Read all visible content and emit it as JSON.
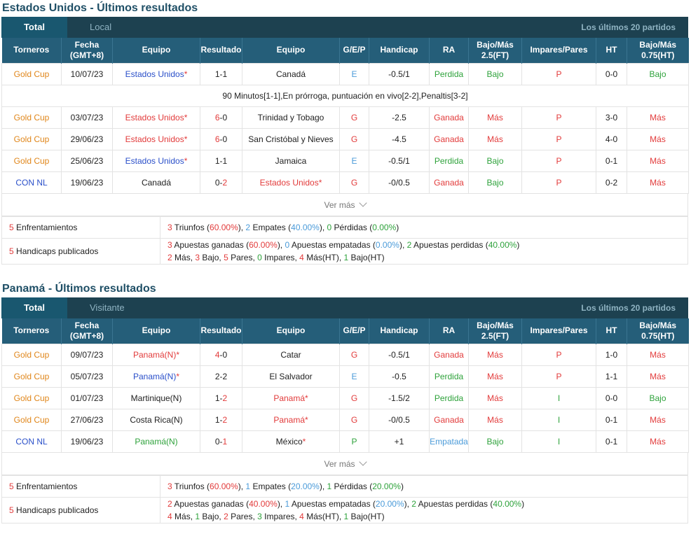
{
  "headers": [
    "Torneros",
    "Fecha\n(GMT+8)",
    "Equipo",
    "Resultado",
    "Equipo",
    "G/E/P",
    "Handicap",
    "RA",
    "Bajo/Más\n2.5(FT)",
    "Impares/Pares",
    "HT",
    "Bajo/Más\n0.75(HT)"
  ],
  "ver_mas": "Ver más",
  "colors": {
    "orange": "#e0861a",
    "blue": "#2a4fc9",
    "red": "#e23b3b",
    "green": "#2ea23b",
    "lightblue": "#4b9bd9",
    "header": "#255e79"
  },
  "sections": [
    {
      "title": "Estados Unidos - Últimos resultados",
      "tab_total": "Total",
      "tab_second": "Local",
      "tab_last": "Los últimos 20 partidos",
      "rows": [
        {
          "torneo": "Gold Cup",
          "torneo_c": "org",
          "fecha": "10/07/23",
          "home": "Estados Unidos",
          "home_star": "*",
          "home_c": "blue",
          "score_h": "1",
          "score_sep": "-",
          "score_a": "1",
          "sh_c": "dark",
          "sa_c": "dark",
          "away": "Canadá",
          "away_star": "",
          "away_c": "dark",
          "gep": "E",
          "gep_c": "lblue",
          "handicap": "-0.5/1",
          "ra": "Perdida",
          "ra_c": "green",
          "bm": "Bajo",
          "bm_c": "green",
          "ip": "P",
          "ip_c": "red",
          "ht": "0-0",
          "bmht": "Bajo",
          "bmht_c": "green"
        },
        {
          "note": "90 Minutos[1-1],En prórroga, puntuación en vivo[2-2],Penaltis[3-2]"
        },
        {
          "torneo": "Gold Cup",
          "torneo_c": "org",
          "fecha": "03/07/23",
          "home": "Estados Unidos",
          "home_star": "*",
          "home_c": "red",
          "score_h": "6",
          "score_sep": "-",
          "score_a": "0",
          "sh_c": "red",
          "sa_c": "dark",
          "away": "Trinidad y Tobago",
          "away_star": "",
          "away_c": "dark",
          "gep": "G",
          "gep_c": "red",
          "handicap": "-2.5",
          "ra": "Ganada",
          "ra_c": "red",
          "bm": "Más",
          "bm_c": "red",
          "ip": "P",
          "ip_c": "red",
          "ht": "3-0",
          "bmht": "Más",
          "bmht_c": "red"
        },
        {
          "torneo": "Gold Cup",
          "torneo_c": "org",
          "fecha": "29/06/23",
          "home": "Estados Unidos",
          "home_star": "*",
          "home_c": "red",
          "score_h": "6",
          "score_sep": "-",
          "score_a": "0",
          "sh_c": "red",
          "sa_c": "dark",
          "away": "San Cristóbal y Nieves",
          "away_star": "",
          "away_c": "dark",
          "gep": "G",
          "gep_c": "red",
          "handicap": "-4.5",
          "ra": "Ganada",
          "ra_c": "red",
          "bm": "Más",
          "bm_c": "red",
          "ip": "P",
          "ip_c": "red",
          "ht": "4-0",
          "bmht": "Más",
          "bmht_c": "red"
        },
        {
          "torneo": "Gold Cup",
          "torneo_c": "org",
          "fecha": "25/06/23",
          "home": "Estados Unidos",
          "home_star": "*",
          "home_c": "blue",
          "score_h": "1",
          "score_sep": "-",
          "score_a": "1",
          "sh_c": "dark",
          "sa_c": "dark",
          "away": "Jamaica",
          "away_star": "",
          "away_c": "dark",
          "gep": "E",
          "gep_c": "lblue",
          "handicap": "-0.5/1",
          "ra": "Perdida",
          "ra_c": "green",
          "bm": "Bajo",
          "bm_c": "green",
          "ip": "P",
          "ip_c": "red",
          "ht": "0-1",
          "bmht": "Más",
          "bmht_c": "red"
        },
        {
          "torneo": "CON NL",
          "torneo_c": "blue",
          "fecha": "19/06/23",
          "home": "Canadá",
          "home_star": "",
          "home_c": "dark",
          "score_h": "0",
          "score_sep": "-",
          "score_a": "2",
          "sh_c": "dark",
          "sa_c": "red",
          "away": "Estados Unidos",
          "away_star": "*",
          "away_c": "red",
          "gep": "G",
          "gep_c": "red",
          "handicap": "-0/0.5",
          "ra": "Ganada",
          "ra_c": "red",
          "bm": "Bajo",
          "bm_c": "green",
          "ip": "P",
          "ip_c": "red",
          "ht": "0-2",
          "bmht": "Más",
          "bmht_c": "red"
        }
      ],
      "summary": {
        "enf_count": "5",
        "enf_label": " Enfrentamientos",
        "enf_parts": [
          {
            "t": "3",
            "c": "red"
          },
          {
            "t": " Triunfos (",
            "c": "dark"
          },
          {
            "t": "60.00%",
            "c": "red"
          },
          {
            "t": "), ",
            "c": "dark"
          },
          {
            "t": "2",
            "c": "lblue"
          },
          {
            "t": " Empates (",
            "c": "dark"
          },
          {
            "t": "40.00%",
            "c": "lblue"
          },
          {
            "t": "), ",
            "c": "dark"
          },
          {
            "t": "0",
            "c": "green"
          },
          {
            "t": " Pérdidas (",
            "c": "dark"
          },
          {
            "t": "0.00%",
            "c": "green"
          },
          {
            "t": ")",
            "c": "dark"
          }
        ],
        "hand_count": "5",
        "hand_label": " Handicaps publicados",
        "hand_line1": [
          {
            "t": "3",
            "c": "red"
          },
          {
            "t": " Apuestas ganadas (",
            "c": "dark"
          },
          {
            "t": "60.00%",
            "c": "red"
          },
          {
            "t": "), ",
            "c": "dark"
          },
          {
            "t": "0",
            "c": "lblue"
          },
          {
            "t": " Apuestas empatadas (",
            "c": "dark"
          },
          {
            "t": "0.00%",
            "c": "lblue"
          },
          {
            "t": "), ",
            "c": "dark"
          },
          {
            "t": "2",
            "c": "green"
          },
          {
            "t": " Apuestas perdidas (",
            "c": "dark"
          },
          {
            "t": "40.00%",
            "c": "green"
          },
          {
            "t": ")",
            "c": "dark"
          }
        ],
        "hand_line2": [
          {
            "t": "2",
            "c": "red"
          },
          {
            "t": " Más, ",
            "c": "dark"
          },
          {
            "t": "3",
            "c": "red"
          },
          {
            "t": " Bajo, ",
            "c": "dark"
          },
          {
            "t": "5",
            "c": "red"
          },
          {
            "t": " Pares, ",
            "c": "dark"
          },
          {
            "t": "0",
            "c": "green"
          },
          {
            "t": " Impares, ",
            "c": "dark"
          },
          {
            "t": "4",
            "c": "red"
          },
          {
            "t": " Más(HT), ",
            "c": "dark"
          },
          {
            "t": "1",
            "c": "green"
          },
          {
            "t": " Bajo(HT)",
            "c": "dark"
          }
        ]
      }
    },
    {
      "title": "Panamá - Últimos resultados",
      "tab_total": "Total",
      "tab_second": "Visitante",
      "tab_last": "Los últimos 20 partidos",
      "rows": [
        {
          "torneo": "Gold Cup",
          "torneo_c": "org",
          "fecha": "09/07/23",
          "home": "Panamá(N)",
          "home_star": "*",
          "home_c": "red",
          "score_h": "4",
          "score_sep": "-",
          "score_a": "0",
          "sh_c": "red",
          "sa_c": "dark",
          "away": "Catar",
          "away_star": "",
          "away_c": "dark",
          "gep": "G",
          "gep_c": "red",
          "handicap": "-0.5/1",
          "ra": "Ganada",
          "ra_c": "red",
          "bm": "Más",
          "bm_c": "red",
          "ip": "P",
          "ip_c": "red",
          "ht": "1-0",
          "bmht": "Más",
          "bmht_c": "red"
        },
        {
          "torneo": "Gold Cup",
          "torneo_c": "org",
          "fecha": "05/07/23",
          "home": "Panamá(N)",
          "home_star": "*",
          "home_c": "blue",
          "score_h": "2",
          "score_sep": "-",
          "score_a": "2",
          "sh_c": "dark",
          "sa_c": "dark",
          "away": "El Salvador",
          "away_star": "",
          "away_c": "dark",
          "gep": "E",
          "gep_c": "lblue",
          "handicap": "-0.5",
          "ra": "Perdida",
          "ra_c": "green",
          "bm": "Más",
          "bm_c": "red",
          "ip": "P",
          "ip_c": "red",
          "ht": "1-1",
          "bmht": "Más",
          "bmht_c": "red"
        },
        {
          "torneo": "Gold Cup",
          "torneo_c": "org",
          "fecha": "01/07/23",
          "home": "Martinique(N)",
          "home_star": "",
          "home_c": "dark",
          "score_h": "1",
          "score_sep": "-",
          "score_a": "2",
          "sh_c": "dark",
          "sa_c": "red",
          "away": "Panamá",
          "away_star": "*",
          "away_c": "red",
          "gep": "G",
          "gep_c": "red",
          "handicap": "-1.5/2",
          "ra": "Perdida",
          "ra_c": "green",
          "bm": "Más",
          "bm_c": "red",
          "ip": "I",
          "ip_c": "green",
          "ht": "0-0",
          "bmht": "Bajo",
          "bmht_c": "green"
        },
        {
          "torneo": "Gold Cup",
          "torneo_c": "org",
          "fecha": "27/06/23",
          "home": "Costa Rica(N)",
          "home_star": "",
          "home_c": "dark",
          "score_h": "1",
          "score_sep": "-",
          "score_a": "2",
          "sh_c": "dark",
          "sa_c": "red",
          "away": "Panamá",
          "away_star": "*",
          "away_c": "red",
          "gep": "G",
          "gep_c": "red",
          "handicap": "-0/0.5",
          "ra": "Ganada",
          "ra_c": "red",
          "bm": "Más",
          "bm_c": "red",
          "ip": "I",
          "ip_c": "green",
          "ht": "0-1",
          "bmht": "Más",
          "bmht_c": "red"
        },
        {
          "torneo": "CON NL",
          "torneo_c": "blue",
          "fecha": "19/06/23",
          "home": "Panamá(N)",
          "home_star": "",
          "home_c": "green",
          "score_h": "0",
          "score_sep": "-",
          "score_a": "1",
          "sh_c": "dark",
          "sa_c": "red",
          "away": "México",
          "away_star": "*",
          "away_c": "dark",
          "gep": "P",
          "gep_c": "green",
          "handicap": "+1",
          "ra": "Empatada",
          "ra_c": "lblue",
          "bm": "Bajo",
          "bm_c": "green",
          "ip": "I",
          "ip_c": "green",
          "ht": "0-1",
          "bmht": "Más",
          "bmht_c": "red"
        }
      ],
      "summary": {
        "enf_count": "5",
        "enf_label": " Enfrentamientos",
        "enf_parts": [
          {
            "t": "3",
            "c": "red"
          },
          {
            "t": " Triunfos (",
            "c": "dark"
          },
          {
            "t": "60.00%",
            "c": "red"
          },
          {
            "t": "), ",
            "c": "dark"
          },
          {
            "t": "1",
            "c": "lblue"
          },
          {
            "t": " Empates (",
            "c": "dark"
          },
          {
            "t": "20.00%",
            "c": "lblue"
          },
          {
            "t": "), ",
            "c": "dark"
          },
          {
            "t": "1",
            "c": "green"
          },
          {
            "t": " Pérdidas (",
            "c": "dark"
          },
          {
            "t": "20.00%",
            "c": "green"
          },
          {
            "t": ")",
            "c": "dark"
          }
        ],
        "hand_count": "5",
        "hand_label": " Handicaps publicados",
        "hand_line1": [
          {
            "t": "2",
            "c": "red"
          },
          {
            "t": " Apuestas ganadas (",
            "c": "dark"
          },
          {
            "t": "40.00%",
            "c": "red"
          },
          {
            "t": "), ",
            "c": "dark"
          },
          {
            "t": "1",
            "c": "lblue"
          },
          {
            "t": " Apuestas empatadas (",
            "c": "dark"
          },
          {
            "t": "20.00%",
            "c": "lblue"
          },
          {
            "t": "), ",
            "c": "dark"
          },
          {
            "t": "2",
            "c": "green"
          },
          {
            "t": " Apuestas perdidas (",
            "c": "dark"
          },
          {
            "t": "40.00%",
            "c": "green"
          },
          {
            "t": ")",
            "c": "dark"
          }
        ],
        "hand_line2": [
          {
            "t": "4",
            "c": "red"
          },
          {
            "t": " Más, ",
            "c": "dark"
          },
          {
            "t": "1",
            "c": "green"
          },
          {
            "t": " Bajo, ",
            "c": "dark"
          },
          {
            "t": "2",
            "c": "red"
          },
          {
            "t": " Pares, ",
            "c": "dark"
          },
          {
            "t": "3",
            "c": "green"
          },
          {
            "t": " Impares, ",
            "c": "dark"
          },
          {
            "t": "4",
            "c": "red"
          },
          {
            "t": " Más(HT), ",
            "c": "dark"
          },
          {
            "t": "1",
            "c": "green"
          },
          {
            "t": " Bajo(HT)",
            "c": "dark"
          }
        ]
      }
    }
  ]
}
